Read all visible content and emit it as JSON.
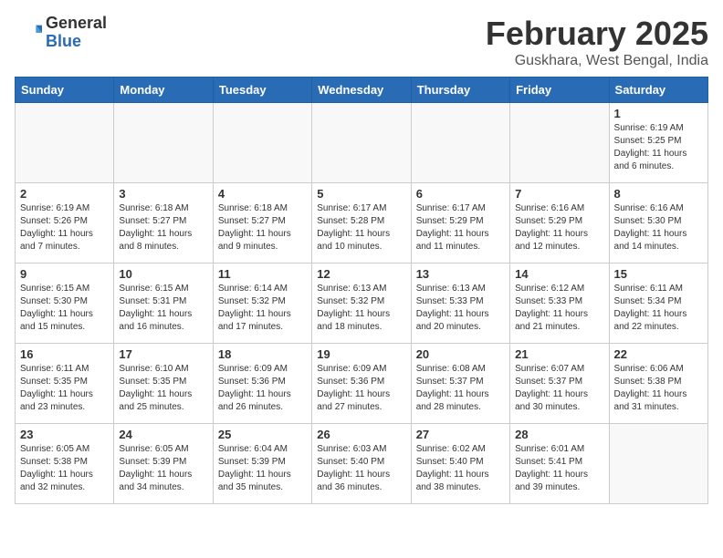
{
  "logo": {
    "general": "General",
    "blue": "Blue"
  },
  "title": "February 2025",
  "location": "Guskhara, West Bengal, India",
  "weekdays": [
    "Sunday",
    "Monday",
    "Tuesday",
    "Wednesday",
    "Thursday",
    "Friday",
    "Saturday"
  ],
  "weeks": [
    [
      {
        "day": "",
        "info": ""
      },
      {
        "day": "",
        "info": ""
      },
      {
        "day": "",
        "info": ""
      },
      {
        "day": "",
        "info": ""
      },
      {
        "day": "",
        "info": ""
      },
      {
        "day": "",
        "info": ""
      },
      {
        "day": "1",
        "info": "Sunrise: 6:19 AM\nSunset: 5:25 PM\nDaylight: 11 hours and 6 minutes."
      }
    ],
    [
      {
        "day": "2",
        "info": "Sunrise: 6:19 AM\nSunset: 5:26 PM\nDaylight: 11 hours and 7 minutes."
      },
      {
        "day": "3",
        "info": "Sunrise: 6:18 AM\nSunset: 5:27 PM\nDaylight: 11 hours and 8 minutes."
      },
      {
        "day": "4",
        "info": "Sunrise: 6:18 AM\nSunset: 5:27 PM\nDaylight: 11 hours and 9 minutes."
      },
      {
        "day": "5",
        "info": "Sunrise: 6:17 AM\nSunset: 5:28 PM\nDaylight: 11 hours and 10 minutes."
      },
      {
        "day": "6",
        "info": "Sunrise: 6:17 AM\nSunset: 5:29 PM\nDaylight: 11 hours and 11 minutes."
      },
      {
        "day": "7",
        "info": "Sunrise: 6:16 AM\nSunset: 5:29 PM\nDaylight: 11 hours and 12 minutes."
      },
      {
        "day": "8",
        "info": "Sunrise: 6:16 AM\nSunset: 5:30 PM\nDaylight: 11 hours and 14 minutes."
      }
    ],
    [
      {
        "day": "9",
        "info": "Sunrise: 6:15 AM\nSunset: 5:30 PM\nDaylight: 11 hours and 15 minutes."
      },
      {
        "day": "10",
        "info": "Sunrise: 6:15 AM\nSunset: 5:31 PM\nDaylight: 11 hours and 16 minutes."
      },
      {
        "day": "11",
        "info": "Sunrise: 6:14 AM\nSunset: 5:32 PM\nDaylight: 11 hours and 17 minutes."
      },
      {
        "day": "12",
        "info": "Sunrise: 6:13 AM\nSunset: 5:32 PM\nDaylight: 11 hours and 18 minutes."
      },
      {
        "day": "13",
        "info": "Sunrise: 6:13 AM\nSunset: 5:33 PM\nDaylight: 11 hours and 20 minutes."
      },
      {
        "day": "14",
        "info": "Sunrise: 6:12 AM\nSunset: 5:33 PM\nDaylight: 11 hours and 21 minutes."
      },
      {
        "day": "15",
        "info": "Sunrise: 6:11 AM\nSunset: 5:34 PM\nDaylight: 11 hours and 22 minutes."
      }
    ],
    [
      {
        "day": "16",
        "info": "Sunrise: 6:11 AM\nSunset: 5:35 PM\nDaylight: 11 hours and 23 minutes."
      },
      {
        "day": "17",
        "info": "Sunrise: 6:10 AM\nSunset: 5:35 PM\nDaylight: 11 hours and 25 minutes."
      },
      {
        "day": "18",
        "info": "Sunrise: 6:09 AM\nSunset: 5:36 PM\nDaylight: 11 hours and 26 minutes."
      },
      {
        "day": "19",
        "info": "Sunrise: 6:09 AM\nSunset: 5:36 PM\nDaylight: 11 hours and 27 minutes."
      },
      {
        "day": "20",
        "info": "Sunrise: 6:08 AM\nSunset: 5:37 PM\nDaylight: 11 hours and 28 minutes."
      },
      {
        "day": "21",
        "info": "Sunrise: 6:07 AM\nSunset: 5:37 PM\nDaylight: 11 hours and 30 minutes."
      },
      {
        "day": "22",
        "info": "Sunrise: 6:06 AM\nSunset: 5:38 PM\nDaylight: 11 hours and 31 minutes."
      }
    ],
    [
      {
        "day": "23",
        "info": "Sunrise: 6:05 AM\nSunset: 5:38 PM\nDaylight: 11 hours and 32 minutes."
      },
      {
        "day": "24",
        "info": "Sunrise: 6:05 AM\nSunset: 5:39 PM\nDaylight: 11 hours and 34 minutes."
      },
      {
        "day": "25",
        "info": "Sunrise: 6:04 AM\nSunset: 5:39 PM\nDaylight: 11 hours and 35 minutes."
      },
      {
        "day": "26",
        "info": "Sunrise: 6:03 AM\nSunset: 5:40 PM\nDaylight: 11 hours and 36 minutes."
      },
      {
        "day": "27",
        "info": "Sunrise: 6:02 AM\nSunset: 5:40 PM\nDaylight: 11 hours and 38 minutes."
      },
      {
        "day": "28",
        "info": "Sunrise: 6:01 AM\nSunset: 5:41 PM\nDaylight: 11 hours and 39 minutes."
      },
      {
        "day": "",
        "info": ""
      }
    ]
  ]
}
